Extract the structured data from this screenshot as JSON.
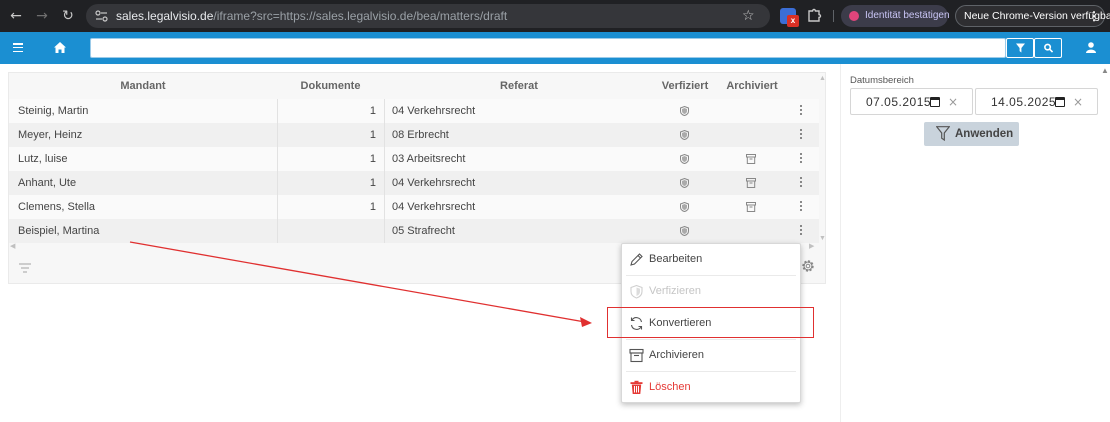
{
  "browser": {
    "url_host": "sales.legalvisio.de",
    "url_path": "/iframe?src=https://sales.legalvisio.de/bea/matters/draft",
    "identity_label": "Identität bestätigen",
    "update_label": "Neue Chrome-Version verfügbar",
    "extension_badge": "x"
  },
  "search": {
    "value": "",
    "placeholder": ""
  },
  "table": {
    "headers": {
      "mandant": "Mandant",
      "dokumente": "Dokumente",
      "referat": "Referat",
      "verfiziert": "Verfiziert",
      "archiviert": "Archiviert"
    },
    "rows": [
      {
        "mandant": "Steinig, Martin",
        "dokumente": "1",
        "referat": "04 Verkehrsrecht",
        "archived": false
      },
      {
        "mandant": "Meyer, Heinz",
        "dokumente": "1",
        "referat": "08 Erbrecht",
        "archived": false
      },
      {
        "mandant": "Lutz, luise",
        "dokumente": "1",
        "referat": "03 Arbeitsrecht",
        "archived": true
      },
      {
        "mandant": "Anhant, Ute",
        "dokumente": "1",
        "referat": "04 Verkehrsrecht",
        "archived": true
      },
      {
        "mandant": "Clemens, Stella",
        "dokumente": "1",
        "referat": "04 Verkehrsrecht",
        "archived": true
      },
      {
        "mandant": "Beispiel, Martina",
        "dokumente": "",
        "referat": "05 Strafrecht",
        "archived": false
      }
    ]
  },
  "filter_panel": {
    "date_range_label": "Datumsbereich",
    "from_date": "07.05.2015",
    "to_date": "14.05.2025",
    "apply_label": "Anwenden"
  },
  "context_menu": {
    "edit": "Bearbeiten",
    "verify": "Verfizieren",
    "convert": "Konvertieren",
    "archive": "Archivieren",
    "delete": "Löschen"
  },
  "colors": {
    "header_blue": "#1b8fd2",
    "danger_red": "#e53935",
    "annotation_red": "#e03030"
  }
}
